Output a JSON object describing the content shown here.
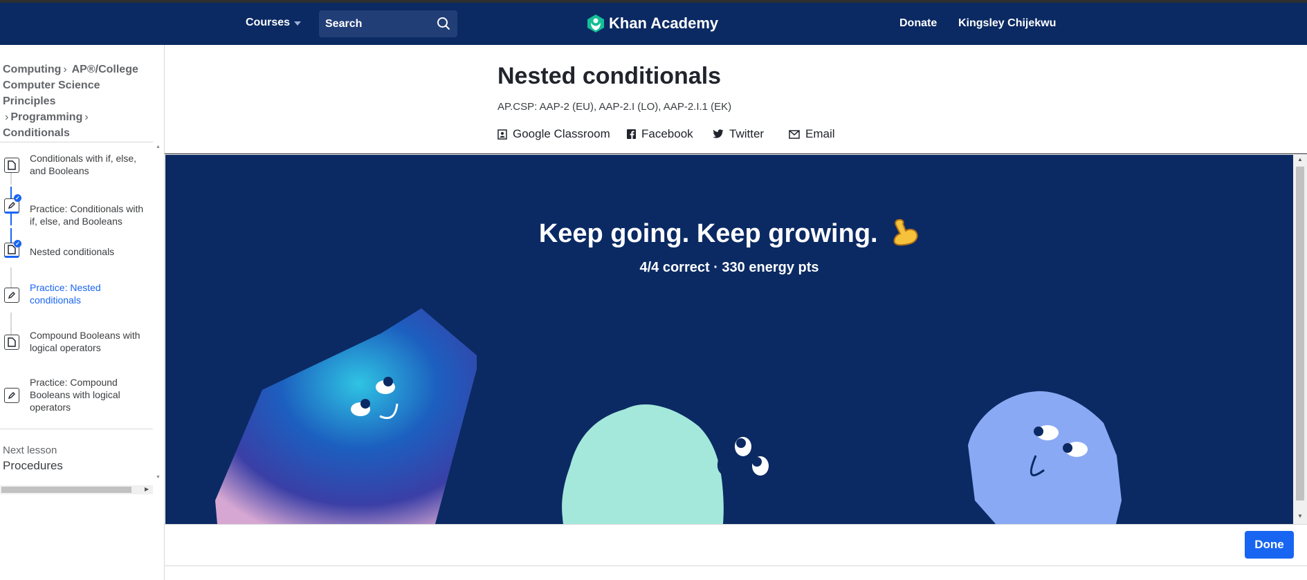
{
  "nav": {
    "courses": "Courses",
    "search_placeholder": "Search",
    "logo_text": "Khan Academy",
    "donate": "Donate",
    "user": "Kingsley Chijekwu"
  },
  "breadcrumb": {
    "items": [
      "Computing",
      "AP®︎/College Computer Science Principles",
      "Programming",
      "Conditionals"
    ]
  },
  "sidebar": {
    "items": [
      {
        "label": "Conditionals with if, else, and Booleans",
        "type": "article",
        "completed": false
      },
      {
        "label": "Practice: Conditionals with if, else, and Booleans",
        "type": "exercise",
        "completed": true
      },
      {
        "label": "Nested conditionals",
        "type": "article",
        "completed": true
      },
      {
        "label": "Practice: Nested conditionals",
        "type": "exercise",
        "completed": false,
        "active": true
      },
      {
        "label": "Compound Booleans with logical operators",
        "type": "article",
        "completed": false
      },
      {
        "label": "Practice: Compound Booleans with logical operators",
        "type": "exercise",
        "completed": false
      }
    ],
    "next_lesson_label": "Next lesson",
    "next_lesson": "Procedures"
  },
  "content": {
    "title": "Nested conditionals",
    "standards": "AP.CSP: AAP-2 (EU), AAP-2.I (LO), AAP-2.I.1 (EK)",
    "share": {
      "classroom": "Google Classroom",
      "facebook": "Facebook",
      "twitter": "Twitter",
      "email": "Email"
    }
  },
  "result": {
    "headline": "Keep going. Keep growing.",
    "summary": "4/4 correct · 330 energy pts"
  },
  "footer": {
    "done": "Done"
  },
  "colors": {
    "navy": "#0b2a63",
    "accent": "#1865f2",
    "teal": "#a4e8dc",
    "periwinkle": "#8aa9f4"
  },
  "icons": [
    "search-icon",
    "khan-logo-icon",
    "article-icon",
    "exercise-icon",
    "check-icon",
    "classroom-icon",
    "facebook-icon",
    "twitter-icon",
    "email-icon",
    "flexed-biceps-icon"
  ]
}
